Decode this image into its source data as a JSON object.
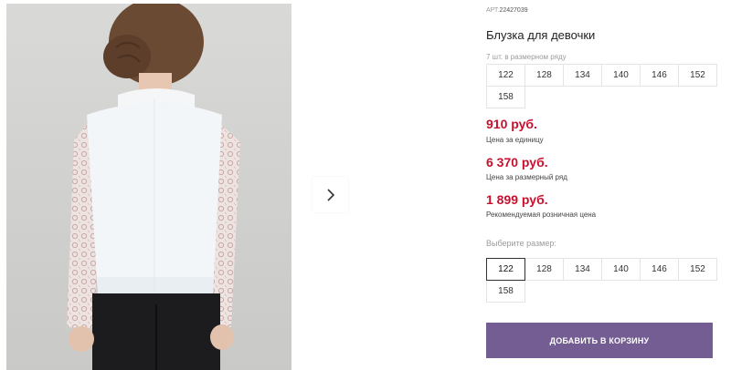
{
  "gallery": {
    "next_icon": "chevron-right-icon"
  },
  "product": {
    "sku_label": "АРТ.",
    "sku_value": "22427039",
    "title": "Блузка для девочки",
    "row_note": "7 шт. в размерном ряду",
    "row_sizes": [
      "122",
      "128",
      "134",
      "140",
      "146",
      "152",
      "158"
    ],
    "prices": [
      {
        "value": "910 руб.",
        "caption": "Цена за единицу"
      },
      {
        "value": "6 370 руб.",
        "caption": "Цена за размерный ряд"
      },
      {
        "value": "1 899 руб.",
        "caption": "Рекомендуемая розничная цена"
      }
    ],
    "choose_label": "Выберите размер:",
    "select_sizes": [
      "122",
      "128",
      "134",
      "140",
      "146",
      "152",
      "158"
    ],
    "selected_size": "122",
    "cart_button": "ДОБАВИТЬ В КОРЗИНУ"
  },
  "colors": {
    "price": "#c8102e",
    "button": "#735d92"
  }
}
